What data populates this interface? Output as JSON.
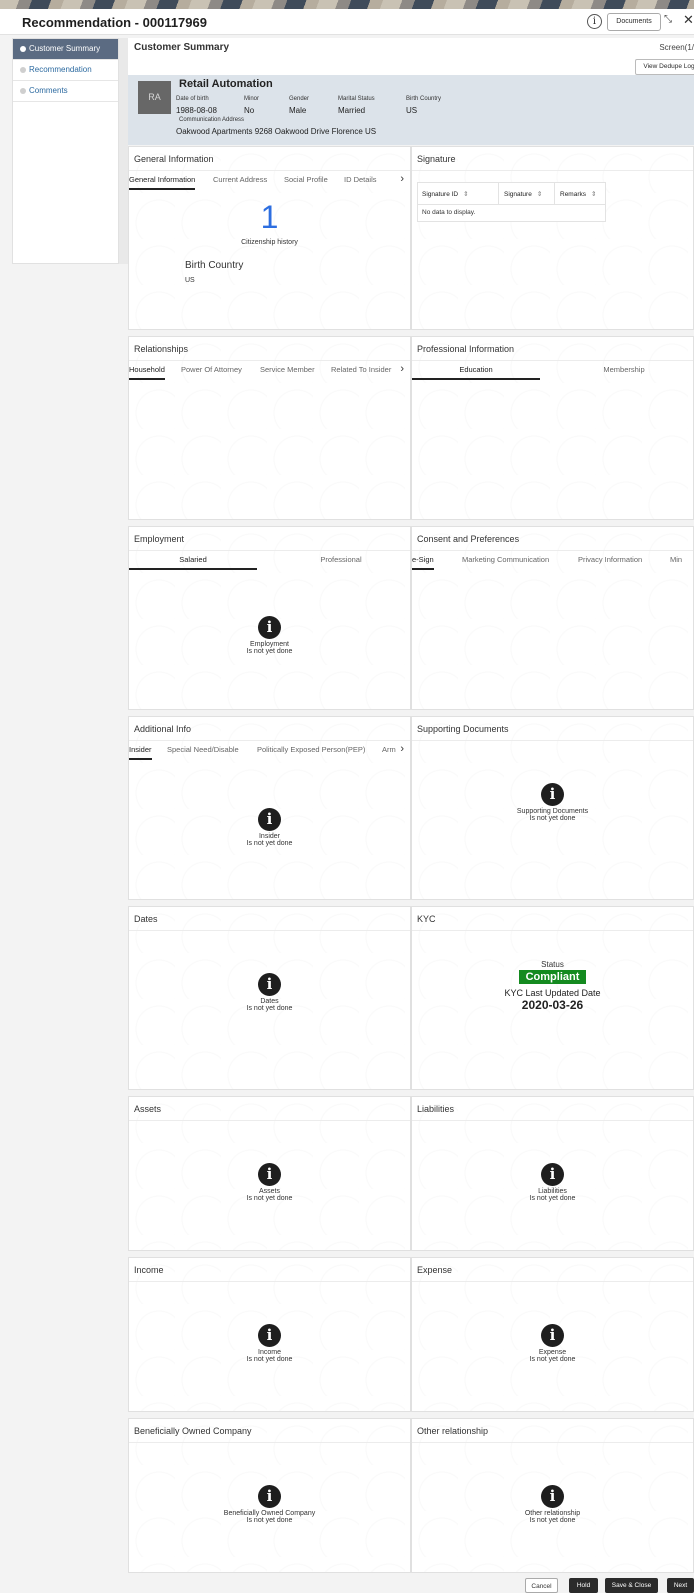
{
  "window": {
    "title": "Recommendation - 000117969",
    "info_icon": "i",
    "documents_button": "Documents",
    "expand_icon": "⤡",
    "close_icon": "✕"
  },
  "sidebar": {
    "items": [
      {
        "label": "Customer Summary",
        "active": true
      },
      {
        "label": "Recommendation",
        "active": false
      },
      {
        "label": "Comments",
        "active": false
      }
    ]
  },
  "main": {
    "title": "Customer Summary",
    "screen_indicator": "Screen(1/",
    "dedupe_button": "View Dedupe Log"
  },
  "customer": {
    "initials": "RA",
    "name": "Retail Automation",
    "dob_label": "Date of birth",
    "dob": "1988-08-08",
    "minor_label": "Minor",
    "minor": "No",
    "gender_label": "Gender",
    "gender": "Male",
    "marital_label": "Marital Status",
    "marital": "Married",
    "birth_country_label": "Birth Country",
    "birth_country": "US",
    "address_label": "Communication Address",
    "address": "Oakwood Apartments 9268 Oakwood Drive Florence US"
  },
  "general_info": {
    "title": "General Information",
    "tabs": [
      "General Information",
      "Current Address",
      "Social Profile",
      "ID Details"
    ],
    "citizenship_count": "1",
    "citizenship_label": "Citizenship history",
    "birth_country_label": "Birth Country",
    "birth_country": "US"
  },
  "signature": {
    "title": "Signature",
    "columns": [
      "Signature ID",
      "Signature",
      "Remarks"
    ],
    "sort_icon": "⇕",
    "empty": "No data to display."
  },
  "relationships": {
    "title": "Relationships",
    "tabs": [
      "Household",
      "Power Of Attorney",
      "Service Member",
      "Related To Insider"
    ]
  },
  "professional_info": {
    "title": "Professional Information",
    "tabs": [
      "Education",
      "Membership"
    ]
  },
  "employment": {
    "title": "Employment",
    "tabs": [
      "Salaried",
      "Professional"
    ],
    "empty_title": "Employment",
    "empty_sub": "Is not yet done"
  },
  "consent": {
    "title": "Consent and Preferences",
    "tabs": [
      "e-Sign",
      "Marketing Communication",
      "Privacy Information",
      "Min"
    ]
  },
  "additional_info": {
    "title": "Additional Info",
    "tabs": [
      "Insider",
      "Special Need/Disable",
      "Politically Exposed Person(PEP)",
      "Arm"
    ],
    "empty_title": "Insider",
    "empty_sub": "Is not yet done"
  },
  "supporting_docs": {
    "title": "Supporting Documents",
    "empty_title": "Supporting Documents",
    "empty_sub": "Is not yet done"
  },
  "dates": {
    "title": "Dates",
    "empty_title": "Dates",
    "empty_sub": "Is not yet done"
  },
  "kyc": {
    "title": "KYC",
    "status_label": "Status",
    "status": "Compliant",
    "status_color": "#148a1f",
    "updated_label": "KYC Last Updated Date",
    "updated_date": "2020-03-26"
  },
  "assets": {
    "title": "Assets",
    "empty_title": "Assets",
    "empty_sub": "Is not yet done"
  },
  "liabilities": {
    "title": "Liabilities",
    "empty_title": "Liabilities",
    "empty_sub": "Is not yet done"
  },
  "income": {
    "title": "Income",
    "empty_title": "Income",
    "empty_sub": "Is not yet done"
  },
  "expense": {
    "title": "Expense",
    "empty_title": "Expense",
    "empty_sub": "Is not yet done"
  },
  "beneficial": {
    "title": "Beneficially Owned Company",
    "empty_title": "Beneficially Owned Company",
    "empty_sub": "Is not yet done"
  },
  "other_rel": {
    "title": "Other relationship",
    "empty_title": "Other relationship",
    "empty_sub": "Is not yet done"
  },
  "icons": {
    "info": "i",
    "chevron_right": "›"
  },
  "footer": {
    "cancel": "Cancel",
    "hold": "Hold",
    "save_close": "Save & Close",
    "next": "Next"
  }
}
